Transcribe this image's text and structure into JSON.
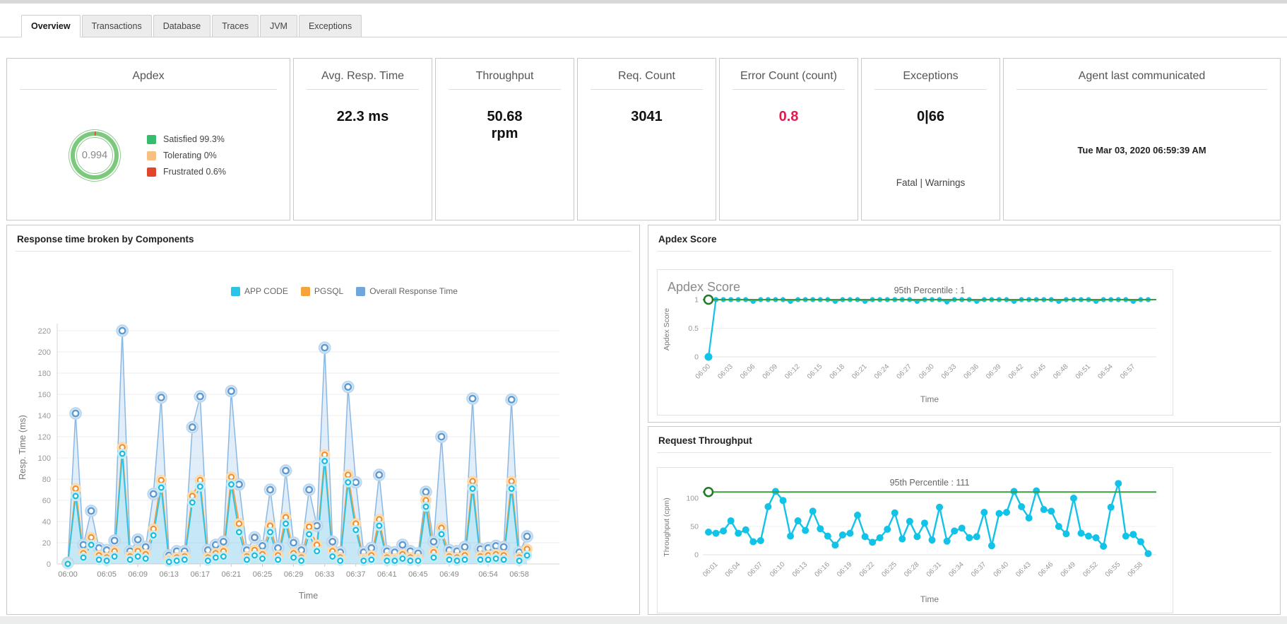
{
  "tabs": [
    {
      "label": "Overview",
      "active": true
    },
    {
      "label": "Transactions",
      "active": false
    },
    {
      "label": "Database",
      "active": false
    },
    {
      "label": "Traces",
      "active": false
    },
    {
      "label": "JVM",
      "active": false
    },
    {
      "label": "Exceptions",
      "active": false
    }
  ],
  "cards": [
    {
      "title": "Apdex",
      "gauge_value": "0.994",
      "legend": [
        {
          "label": "Satisfied 99.3%",
          "color": "#35bd6d"
        },
        {
          "label": "Tolerating 0%",
          "color": "#f8bf82"
        },
        {
          "label": "Frustrated 0.6%",
          "color": "#e2452c"
        }
      ]
    },
    {
      "title": "Avg. Resp. Time",
      "value": "22.3 ms"
    },
    {
      "title": "Throughput",
      "value": "50.68",
      "value2": "rpm"
    },
    {
      "title": "Req. Count",
      "value": "3041"
    },
    {
      "title": "Error Count (count)",
      "value": "0.8",
      "value_color": "#e01b4c"
    },
    {
      "title": "Exceptions",
      "value": "0|66",
      "footer": "Fatal | Warnings"
    },
    {
      "title": "Agent last communicated",
      "timestamp": "Tue Mar 03, 2020 06:59:39 AM"
    }
  ],
  "panels": {
    "response": {
      "title": "Response time broken by Components"
    },
    "apdex": {
      "title": "Apdex Score"
    },
    "throughput": {
      "title": "Request Throughput"
    }
  },
  "chart_data": [
    {
      "type": "line",
      "title": "Response time broken by Components",
      "xlabel": "Time",
      "ylabel": "Resp. Time (ms)",
      "ylim": [
        0,
        230
      ],
      "yticks": [
        0,
        20,
        40,
        60,
        80,
        100,
        120,
        140,
        160,
        180,
        200,
        220
      ],
      "x": [
        "06:00",
        "06:01",
        "06:02",
        "06:03",
        "06:04",
        "06:05",
        "06:06",
        "06:07",
        "06:08",
        "06:09",
        "06:10",
        "06:11",
        "06:12",
        "06:13",
        "06:14",
        "06:15",
        "06:16",
        "06:17",
        "06:18",
        "06:19",
        "06:20",
        "06:21",
        "06:22",
        "06:23",
        "06:24",
        "06:25",
        "06:26",
        "06:27",
        "06:28",
        "06:29",
        "06:30",
        "06:31",
        "06:32",
        "06:33",
        "06:34",
        "06:35",
        "06:36",
        "06:37",
        "06:38",
        "06:39",
        "06:40",
        "06:41",
        "06:42",
        "06:43",
        "06:44",
        "06:45",
        "06:46",
        "06:47",
        "06:48",
        "06:49",
        "06:50",
        "06:51",
        "06:52",
        "06:53",
        "06:54",
        "06:55",
        "06:56",
        "06:57",
        "06:58",
        "06:59"
      ],
      "tick_indices": [
        0,
        5,
        9,
        13,
        17,
        21,
        25,
        29,
        33,
        37,
        41,
        45,
        49,
        54,
        58
      ],
      "tick_labels": [
        "06:00",
        "06:05",
        "06:09",
        "06:13",
        "06:17",
        "06:21",
        "06:25",
        "06:29",
        "06:33",
        "06:37",
        "06:41",
        "06:45",
        "06:49",
        "06:54",
        "06:58"
      ],
      "legend_position": "top",
      "grid": true,
      "series": [
        {
          "name": "APP CODE",
          "color": "#2ac4e8",
          "values": [
            0,
            64,
            6,
            18,
            4,
            3,
            7,
            104,
            4,
            7,
            5,
            27,
            72,
            2,
            3,
            4,
            58,
            73,
            3,
            6,
            7,
            75,
            30,
            4,
            8,
            5,
            30,
            4,
            38,
            6,
            3,
            28,
            12,
            97,
            7,
            3,
            77,
            32,
            3,
            4,
            36,
            3,
            3,
            5,
            3,
            3,
            54,
            6,
            28,
            4,
            3,
            4,
            71,
            4,
            4,
            5,
            4,
            71,
            3,
            8
          ]
        },
        {
          "name": "PGSQL",
          "color": "#f5a33c",
          "values": [
            0,
            71,
            10,
            25,
            8,
            6,
            12,
            110,
            7,
            12,
            9,
            33,
            79,
            4,
            6,
            7,
            64,
            79,
            6,
            10,
            12,
            82,
            38,
            7,
            13,
            9,
            36,
            8,
            44,
            10,
            6,
            35,
            18,
            103,
            12,
            6,
            84,
            38,
            5,
            8,
            42,
            6,
            5,
            9,
            6,
            5,
            60,
            11,
            34,
            7,
            6,
            8,
            78,
            7,
            8,
            9,
            8,
            78,
            6,
            14
          ]
        },
        {
          "name": "Overall Response Time",
          "color": "#6fa7db",
          "values": [
            1,
            142,
            18,
            50,
            15,
            13,
            22,
            220,
            12,
            23,
            16,
            66,
            157,
            8,
            12,
            12,
            129,
            158,
            13,
            18,
            21,
            163,
            75,
            13,
            25,
            17,
            70,
            15,
            88,
            20,
            13,
            70,
            36,
            204,
            21,
            11,
            167,
            77,
            11,
            15,
            84,
            12,
            11,
            18,
            12,
            10,
            68,
            21,
            120,
            13,
            12,
            16,
            156,
            14,
            15,
            17,
            16,
            155,
            11,
            26
          ]
        }
      ]
    },
    {
      "type": "line",
      "title": "Apdex Score",
      "xlabel": "Time",
      "ylabel": "Apdex Score",
      "ylim": [
        0,
        1
      ],
      "yticks": [
        0,
        0.5,
        1
      ],
      "percentile_label": "95th Percentile : 1",
      "percentile_value": 1,
      "percentile_color": "#3d9b40",
      "color": "#12c3e8",
      "x": [
        "06:00",
        "06:01",
        "06:02",
        "06:03",
        "06:04",
        "06:05",
        "06:06",
        "06:07",
        "06:08",
        "06:09",
        "06:10",
        "06:11",
        "06:12",
        "06:13",
        "06:14",
        "06:15",
        "06:16",
        "06:17",
        "06:18",
        "06:19",
        "06:20",
        "06:21",
        "06:22",
        "06:23",
        "06:24",
        "06:25",
        "06:26",
        "06:27",
        "06:28",
        "06:29",
        "06:30",
        "06:31",
        "06:32",
        "06:33",
        "06:34",
        "06:35",
        "06:36",
        "06:37",
        "06:38",
        "06:39",
        "06:40",
        "06:41",
        "06:42",
        "06:43",
        "06:44",
        "06:45",
        "06:46",
        "06:47",
        "06:48",
        "06:49",
        "06:50",
        "06:51",
        "06:52",
        "06:53",
        "06:54",
        "06:55",
        "06:56",
        "06:57",
        "06:58",
        "06:59"
      ],
      "tick_indices": [
        0,
        3,
        6,
        9,
        12,
        15,
        18,
        21,
        24,
        27,
        30,
        33,
        36,
        39,
        42,
        45,
        48,
        51,
        54,
        57
      ],
      "values": [
        0,
        1,
        1,
        1,
        1,
        1,
        0.97,
        1,
        1,
        1,
        1,
        0.97,
        1,
        1,
        1,
        1,
        1,
        0.97,
        1,
        1,
        1,
        0.97,
        1,
        1,
        1,
        1,
        1,
        1,
        0.97,
        1,
        1,
        1,
        0.96,
        1,
        1,
        1,
        0.97,
        1,
        1,
        1,
        1,
        0.97,
        1,
        1,
        1,
        1,
        1,
        0.97,
        1,
        1,
        1,
        1,
        0.97,
        1,
        1,
        1,
        1,
        0.97,
        1,
        1
      ]
    },
    {
      "type": "line",
      "title": "Request Throughput",
      "xlabel": "Time",
      "ylabel": "Throughput (cpm)",
      "ylim": [
        0,
        130
      ],
      "yticks": [
        0,
        50,
        100
      ],
      "percentile_label": "95th Percentile : 111",
      "percentile_value": 111,
      "percentile_color": "#3d9b40",
      "color": "#12c3e8",
      "x": [
        "06:00",
        "06:01",
        "06:02",
        "06:03",
        "06:04",
        "06:05",
        "06:06",
        "06:07",
        "06:08",
        "06:09",
        "06:10",
        "06:11",
        "06:12",
        "06:13",
        "06:14",
        "06:15",
        "06:16",
        "06:17",
        "06:18",
        "06:19",
        "06:20",
        "06:21",
        "06:22",
        "06:23",
        "06:24",
        "06:25",
        "06:26",
        "06:27",
        "06:28",
        "06:29",
        "06:30",
        "06:31",
        "06:32",
        "06:33",
        "06:34",
        "06:35",
        "06:36",
        "06:37",
        "06:38",
        "06:39",
        "06:40",
        "06:41",
        "06:42",
        "06:43",
        "06:44",
        "06:45",
        "06:46",
        "06:47",
        "06:48",
        "06:49",
        "06:50",
        "06:51",
        "06:52",
        "06:53",
        "06:54",
        "06:55",
        "06:56",
        "06:57",
        "06:58",
        "06:59"
      ],
      "tick_indices": [
        1,
        4,
        7,
        10,
        13,
        16,
        19,
        22,
        25,
        28,
        31,
        34,
        37,
        40,
        43,
        46,
        49,
        52,
        55,
        58
      ],
      "values": [
        40,
        38,
        42,
        60,
        38,
        44,
        23,
        25,
        85,
        112,
        96,
        33,
        60,
        43,
        77,
        46,
        33,
        17,
        35,
        38,
        70,
        32,
        22,
        30,
        45,
        74,
        28,
        59,
        32,
        56,
        26,
        84,
        24,
        42,
        47,
        30,
        32,
        75,
        16,
        73,
        75,
        112,
        85,
        65,
        113,
        80,
        77,
        50,
        37,
        100,
        38,
        33,
        30,
        15,
        84,
        126,
        33,
        36,
        23,
        2
      ]
    }
  ]
}
